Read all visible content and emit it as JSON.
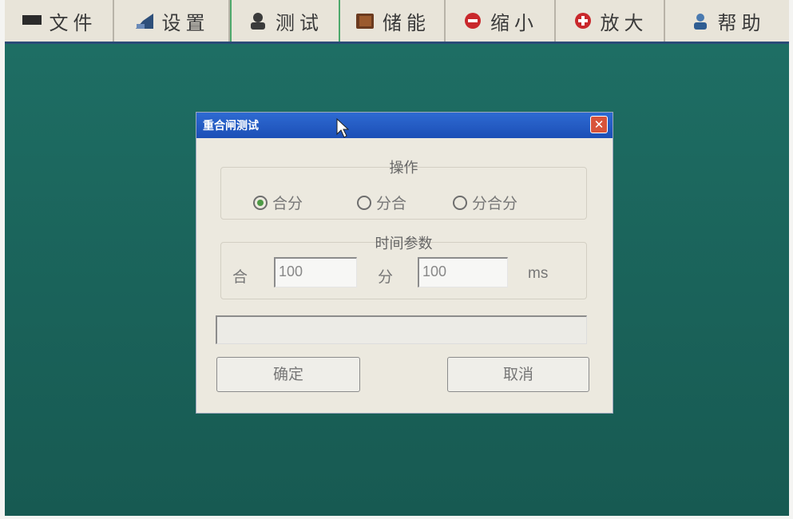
{
  "toolbar": {
    "items": [
      {
        "label": "文件",
        "icon": "monitor-icon"
      },
      {
        "label": "设置",
        "icon": "settings-icon"
      },
      {
        "label": "测试",
        "icon": "person-icon"
      },
      {
        "label": "储能",
        "icon": "book-icon"
      },
      {
        "label": "缩小",
        "icon": "minus-circle-icon"
      },
      {
        "label": "放大",
        "icon": "plus-circle-icon"
      },
      {
        "label": "帮助",
        "icon": "help-icon"
      }
    ]
  },
  "dialog": {
    "title": "重合闸测试",
    "close_glyph": "✕",
    "operation": {
      "title": "操作",
      "options": [
        "合分",
        "分合",
        "分合分"
      ],
      "selected": "合分"
    },
    "time_params": {
      "title": "时间参数",
      "close_label": "合",
      "close_value": "100",
      "open_label": "分",
      "open_value": "100",
      "unit": "ms"
    },
    "buttons": {
      "ok": "确定",
      "cancel": "取消"
    }
  },
  "colors": {
    "desktop": "#1e6e64",
    "titlebar": "#2e6ad2",
    "dialog_bg": "#ece9df"
  }
}
